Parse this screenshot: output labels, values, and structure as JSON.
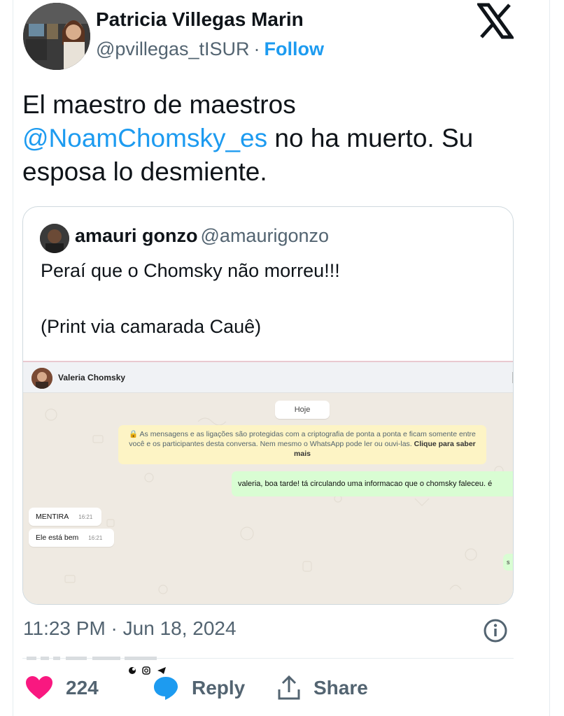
{
  "tweet": {
    "author_name": "Patricia Villegas Marin",
    "author_handle": "@pvillegas_tISUR",
    "separator": "·",
    "follow_label": "Follow",
    "text_part1": "El maestro de maestros ",
    "mention": "@NoamChomsky_es",
    "text_part2": " no ha muerto. Su esposa lo desmiente.",
    "timestamp": "11:23 PM · Jun 18, 2024"
  },
  "quoted": {
    "author_name": "amauri gonzo",
    "author_handle": "@amaurigonzo",
    "text_line1": "Peraí que o Chomsky não morreu!!!",
    "text_line2": "(Print via camarada Cauê)"
  },
  "whatsapp": {
    "contact_name": "Valeria Chomsky",
    "date_chip": "Hoje",
    "notice_text": "🔒 As mensagens e as ligações são protegidas com a criptografia de ponta a ponta e ficam somente entre você e os participantes desta conversa. Nem mesmo o WhatsApp pode ler ou ouvi-las.",
    "notice_link": "Clique para saber mais",
    "outgoing_message": "valeria, boa tarde! tá circulando uma informacao que o chomsky faleceu. é",
    "incoming": [
      {
        "text": "MENTIRA",
        "time": "16:21"
      },
      {
        "text": "Ele está bem",
        "time": "16:21"
      }
    ],
    "outgoing_partial": "s"
  },
  "actions": {
    "like_count": "224",
    "reply_label": "Reply",
    "share_label": "Share"
  },
  "icons": {
    "brand": "x-logo-icon",
    "like": "heart-icon",
    "reply": "speech-bubble-icon",
    "share": "upload-share-icon",
    "info": "info-icon"
  },
  "colors": {
    "accent": "#1d9bf0",
    "like": "#f91880",
    "text_secondary": "#536471",
    "whatsapp_out": "#d9fdd3",
    "whatsapp_notice": "#fdf4c5"
  }
}
